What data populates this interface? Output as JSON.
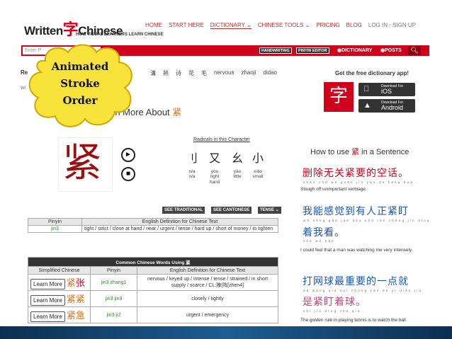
{
  "header": {
    "logo_left": "Written",
    "logo_char": "字",
    "logo_right": "Chinese",
    "tagline": "HOW VISUAL LEARNERS LEARN CHINESE",
    "nav": [
      "HOME",
      "START HERE",
      "DICTIONARY ⌄",
      "CHINESE TOOLS ⌄",
      "PRICING",
      "BLOG",
      "LOG IN · SIGN UP"
    ]
  },
  "toolbar": {
    "search_placeholder": "Enter P",
    "handwriting": "HANDWRITING",
    "pinyin_editor": "PINYIN EDITOR",
    "dictionary": "◉DICTIONARY",
    "posts": "◉POSTS",
    "search_icon": "search-icon"
  },
  "recent": {
    "label": "Re",
    "words": [
      "溝",
      "熱",
      "诗",
      "花",
      "毛",
      "nervous",
      "zhaoji",
      "didao"
    ],
    "wr": "Wr"
  },
  "app": {
    "title": "Get the free dictionary app!",
    "icon_char": "字",
    "ios_sub": "Download For",
    "ios": "iOS",
    "android_sub": "Download For",
    "android": "Android"
  },
  "callout": {
    "line1": "Animated",
    "line2": "Stroke",
    "line3": "Order"
  },
  "learn_more": {
    "text": "rn More About ",
    "char": "紧"
  },
  "character": {
    "glyph": "紧",
    "sound_icon": "speaker-icon",
    "stop_icon": "stop-icon"
  },
  "radicals": {
    "title": "Radicals in this Character",
    "items": [
      {
        "char": "刂",
        "pinyin": "n/a",
        "meaning": "n/a"
      },
      {
        "char": "又",
        "pinyin": "yòu",
        "meaning": "right hand"
      },
      {
        "char": "幺",
        "pinyin": "yāo",
        "meaning": "little"
      },
      {
        "char": "小",
        "pinyin": "xiǎo",
        "meaning": "small"
      }
    ]
  },
  "buttons": {
    "traditional": "SEE TRADITIONAL",
    "cantonese": "SEE CANTONESE",
    "tense": "TENSE ⌄"
  },
  "definition_table": {
    "headers": [
      "Pinyin",
      "English Definition for Chinese Text"
    ],
    "pinyin": "jin3",
    "definition": "tight / strict / close at hand / near / urgent / tense / hard up / short of money / to tighten"
  },
  "words_table": {
    "title": "Common Chinese Words Using 紧",
    "headers": [
      "Simplified Chinese",
      "Pinyin",
      "English Definition for Chinese Text"
    ],
    "learn_more": "Learn More",
    "rows": [
      {
        "c1": "紧",
        "c2": "张",
        "pinyin": "jin3 zhang1",
        "definition": "nervous / keyed up / intense / tense / strained / in short supply / scarce / CL:陣|阵[zhen4]"
      },
      {
        "c1": "紧",
        "c2": "紧",
        "pinyin": "jin3 jin3",
        "definition": "closely / tightly"
      },
      {
        "c1": "紧",
        "c2": "急",
        "pinyin": "jin3 ji2",
        "definition": "urgent / emergency"
      }
    ]
  },
  "sentences": {
    "title_prefix": "How to use ",
    "title_char": "紧",
    "title_suffix": " in a Sentence",
    "s1": "删除无关紧要的空话。",
    "s1_pinyin": "shān chú wú guān jǐn yào de kōng huà .",
    "s1_en": "Slough off unimportant verbiage.",
    "s2a": "我能感觉到有人正紧盯",
    "s2b": "着我看。",
    "s2_pinyin": "wǒ néng gǎn jué dào yǒu rén zhèng jǐn dīng",
    "s2b_pinyin": "zhe wǒ kàn .",
    "s2_en": "I could feel that a man was watching me very intensely.",
    "s3a": "打网球最重要的一点就",
    "s3b": "是紧盯着球。",
    "s3_pinyin": "dǎ wǎng qiú zuì zhòng yào de yī diǎn jiù",
    "s3b_pinyin": "shì jǐn dīng zhe qiú .",
    "s3_en": "The golden rule in playing tennis is to watch the ball"
  }
}
